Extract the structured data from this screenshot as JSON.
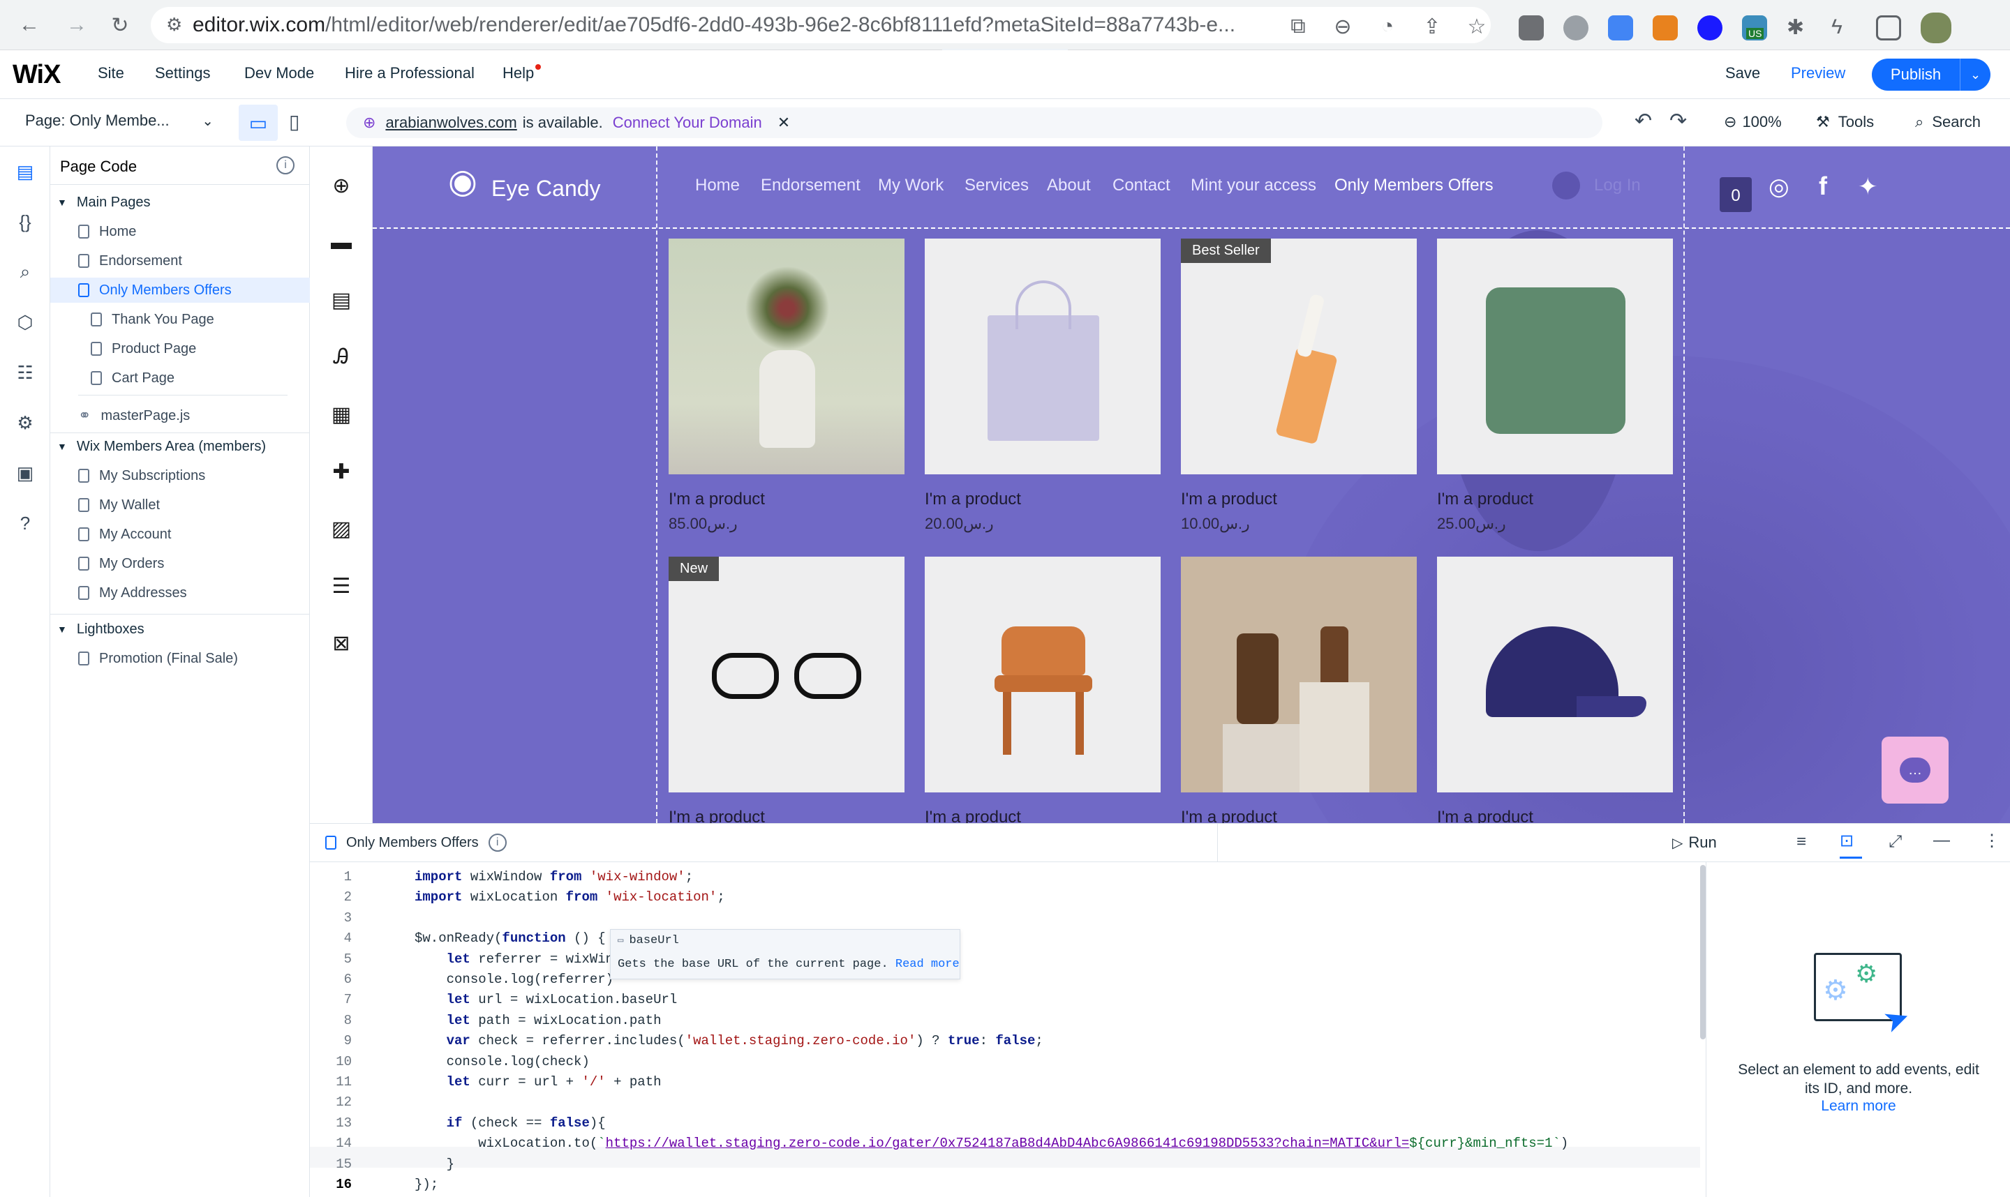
{
  "browser": {
    "url_domain": "editor.wix.com",
    "url_path": "/html/editor/web/renderer/edit/ae705df6-2dd0-493b-96e2-8c6bf8111efd?metaSiteId=88a7743b-e...",
    "ext_badge": "US"
  },
  "wix_top": {
    "logo": "WiX",
    "menu": [
      "Site",
      "Settings",
      "Dev Mode",
      "Hire a Professional",
      "Help"
    ],
    "save": "Save",
    "preview": "Preview",
    "publish": "Publish"
  },
  "bar2": {
    "page_selector": "Page: Only Membe...",
    "domain": "arabianwolves.com",
    "domain_text": "is available.",
    "connect": "Connect Your Domain",
    "zoom": "100%",
    "tools": "Tools",
    "search": "Search"
  },
  "page_code": {
    "title": "Page Code",
    "main_pages": "Main Pages",
    "pages": [
      "Home",
      "Endorsement",
      "Only Members Offers"
    ],
    "subpages": [
      "Thank You Page",
      "Product Page",
      "Cart Page"
    ],
    "master": "masterPage.js",
    "members_area": "Wix Members Area (members)",
    "members_pages": [
      "My Subscriptions",
      "My Wallet",
      "My Account",
      "My Orders",
      "My Addresses"
    ],
    "lightboxes": "Lightboxes",
    "lightbox_items": [
      "Promotion (Final Sale)"
    ]
  },
  "site": {
    "brand": "Eye Candy",
    "nav": [
      "Home",
      "Endorsement",
      "My Work",
      "Services",
      "About",
      "Contact",
      "Mint your access",
      "Only Members Offers"
    ],
    "login": "Log In",
    "cart_count": "0",
    "products": [
      {
        "title": "I'm a product",
        "price": "85.00ر.س",
        "badge": ""
      },
      {
        "title": "I'm a product",
        "price": "20.00ر.س",
        "badge": ""
      },
      {
        "title": "I'm a product",
        "price": "10.00ر.س",
        "badge": "Best Seller"
      },
      {
        "title": "I'm a product",
        "price": "25.00ر.س",
        "badge": ""
      },
      {
        "title": "I'm a product",
        "price": "",
        "badge": "New"
      },
      {
        "title": "I'm a product",
        "price": "",
        "badge": ""
      },
      {
        "title": "I'm a product",
        "price": "",
        "badge": ""
      },
      {
        "title": "I'm a product",
        "price": "",
        "badge": ""
      }
    ]
  },
  "code_panel": {
    "tab": "Only Members Offers",
    "run": "Run",
    "lines": [
      "import wixWindow from 'wix-window';",
      "import wixLocation from 'wix-location';",
      "",
      "$w.onReady(function () {",
      "    let referrer = wixWind",
      "    console.log(referrer)",
      "    let url = wixLocation.baseUrl",
      "    let path = wixLocation.path",
      "    var check = referrer.includes('wallet.staging.zero-code.io') ? true: false;",
      "    console.log(check)",
      "    let curr = url + '/' + path",
      "",
      "    if (check == false){",
      "        wixLocation.to(`https://wallet.staging.zero-code.io/gater/0x7524187aB8d4AbD4Abc6A9866141c69198DD5533?chain=MATIC&url=${curr}&min_nfts=1`)",
      "    }",
      "});"
    ],
    "tooltip_title": "baseUrl",
    "tooltip_text": "Gets the base URL of the current page.",
    "tooltip_link": "Read more",
    "right_text": "Select an element to add events, edit its ID, and more.",
    "right_link": "Learn more"
  },
  "colors": {
    "accent": "#116dff",
    "canvas": "#7069c6"
  }
}
